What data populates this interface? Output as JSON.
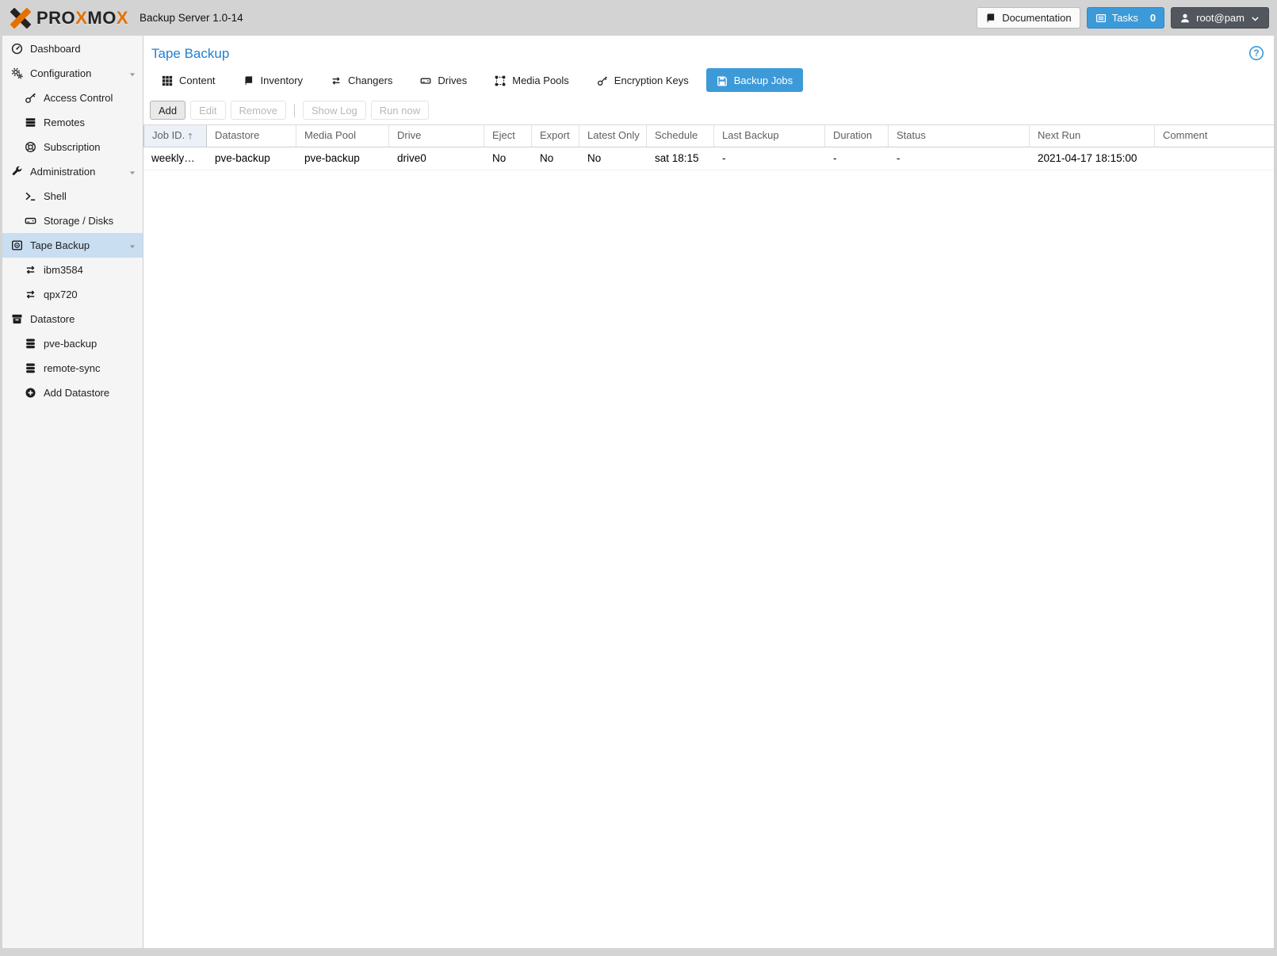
{
  "topbar": {
    "logo": {
      "p1": "PRO",
      "x1": "X",
      "p2": "MO",
      "x2": "X"
    },
    "product": "Backup Server 1.0-14",
    "documentation_label": "Documentation",
    "tasks_label": "Tasks",
    "tasks_count": "0",
    "user_label": "root@pam"
  },
  "sidebar": {
    "items": [
      {
        "label": "Dashboard",
        "icon": "dashboard-icon"
      },
      {
        "label": "Configuration",
        "icon": "gears-icon"
      },
      {
        "label": "Access Control",
        "icon": "key-icon"
      },
      {
        "label": "Remotes",
        "icon": "remotes-icon"
      },
      {
        "label": "Subscription",
        "icon": "life-ring-icon"
      },
      {
        "label": "Administration",
        "icon": "wrench-icon"
      },
      {
        "label": "Shell",
        "icon": "terminal-icon"
      },
      {
        "label": "Storage / Disks",
        "icon": "hdd-icon"
      },
      {
        "label": "Tape Backup",
        "icon": "tape-icon",
        "selected": true
      },
      {
        "label": "ibm3584",
        "icon": "exchange-icon"
      },
      {
        "label": "qpx720",
        "icon": "exchange-icon"
      },
      {
        "label": "Datastore",
        "icon": "archive-icon"
      },
      {
        "label": "pve-backup",
        "icon": "database-icon"
      },
      {
        "label": "remote-sync",
        "icon": "database-icon"
      },
      {
        "label": "Add Datastore",
        "icon": "plus-circle-icon"
      }
    ]
  },
  "content": {
    "title": "Tape Backup",
    "tabs": [
      {
        "label": "Content"
      },
      {
        "label": "Inventory"
      },
      {
        "label": "Changers"
      },
      {
        "label": "Drives"
      },
      {
        "label": "Media Pools"
      },
      {
        "label": "Encryption Keys"
      },
      {
        "label": "Backup Jobs",
        "active": true
      }
    ],
    "toolbar": {
      "add": "Add",
      "edit": "Edit",
      "remove": "Remove",
      "show_log": "Show Log",
      "run_now": "Run now"
    },
    "table": {
      "columns": [
        {
          "label": "Job ID."
        },
        {
          "label": "Datastore"
        },
        {
          "label": "Media Pool"
        },
        {
          "label": "Drive"
        },
        {
          "label": "Eject"
        },
        {
          "label": "Export"
        },
        {
          "label": "Latest Only"
        },
        {
          "label": "Schedule"
        },
        {
          "label": "Last Backup"
        },
        {
          "label": "Duration"
        },
        {
          "label": "Status"
        },
        {
          "label": "Next Run"
        },
        {
          "label": "Comment"
        }
      ],
      "rows": [
        {
          "cells": [
            "weekly…",
            "pve-backup",
            "pve-backup",
            "drive0",
            "No",
            "No",
            "No",
            "sat 18:15",
            "-",
            "-",
            "-",
            "2021-04-17 18:15:00",
            ""
          ]
        }
      ]
    }
  },
  "colors": {
    "accent_blue": "#3d9ad8",
    "title_blue": "#1f7fd4",
    "brand_orange": "#e57000",
    "selected_nav": "#c9def1"
  }
}
